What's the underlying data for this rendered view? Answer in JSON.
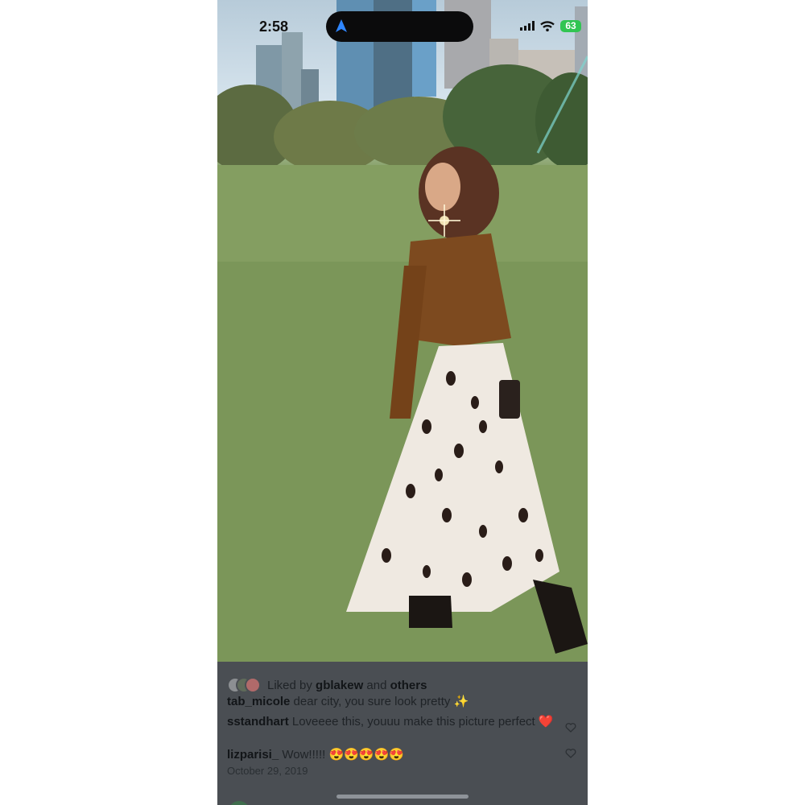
{
  "status_bar": {
    "time": "2:58",
    "battery": "63",
    "icons": [
      "location-arrow-icon",
      "cellular-signal-icon",
      "wifi-icon",
      "battery-charging-icon"
    ]
  },
  "photo": {
    "description_icon": "post-photo"
  },
  "likes": {
    "prefix": "Liked by",
    "user": "gblakew",
    "joiner": "and",
    "others": "others"
  },
  "caption": {
    "user": "tab_micole",
    "text": "dear city, you sure look pretty ✨"
  },
  "comments": [
    {
      "user": "sstandhart",
      "text": "Loveeee this, youuu make this picture perfect ❤️"
    },
    {
      "user": "lizparisi_",
      "text": "Wow!!!!! 😍😍😍😍😍"
    }
  ],
  "date": "October 29, 2019",
  "colors": {
    "background": "#4a4e53",
    "battery": "#31c552"
  }
}
